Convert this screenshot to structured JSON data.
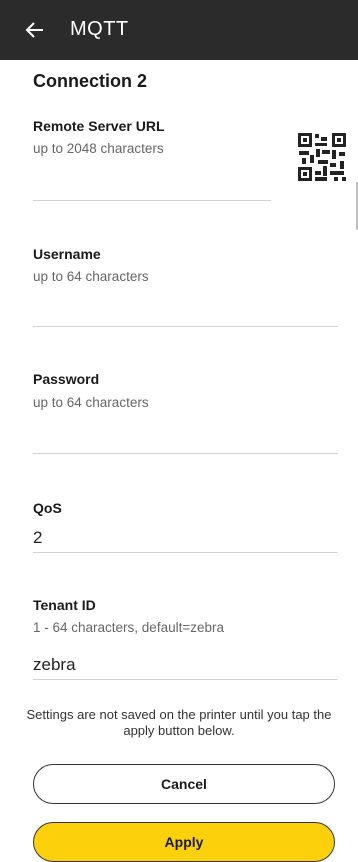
{
  "header": {
    "title": "MQTT",
    "back_icon": "arrow-left-icon"
  },
  "section": {
    "title": "Connection 2"
  },
  "fields": {
    "remote_server_url": {
      "label": "Remote Server URL",
      "hint": "up to 2048 characters",
      "value": "",
      "icon": "qr-code-icon"
    },
    "username": {
      "label": "Username",
      "hint": "up to 64 characters",
      "value": ""
    },
    "password": {
      "label": "Password",
      "hint": "up to 64 characters",
      "value": ""
    },
    "qos": {
      "label": "QoS",
      "value": "2"
    },
    "tenant_id": {
      "label": "Tenant ID",
      "hint": "1 - 64 characters, default=zebra",
      "value": "zebra"
    }
  },
  "notice": "Settings are not saved on the printer until you tap the apply button below.",
  "buttons": {
    "cancel": "Cancel",
    "apply": "Apply"
  },
  "colors": {
    "header_bg": "#2b2b2b",
    "apply_bg": "#fcd10b",
    "underline": "#d2d2d2"
  }
}
